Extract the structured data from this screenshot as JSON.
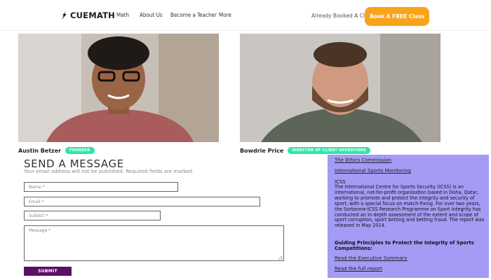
{
  "header": {
    "logo_text": "CUEMATH",
    "nav": [
      "Math",
      "About Us",
      "Become a Teacher",
      "More"
    ],
    "already_booked": "Already Booked A Class?",
    "cta_label": "Book A FREE Class"
  },
  "people": [
    {
      "name": "Austin Betzer",
      "role": "FOUNDER"
    },
    {
      "name": "Bowdrie Price",
      "role": "DIRECTOR OF CLIENT OPERATIONS"
    }
  ],
  "form": {
    "title": "SEND A MESSAGE",
    "note": "Your email address will not be published. Required fields are marked.",
    "name_placeholder": "Name *",
    "email_placeholder": "Email *",
    "subject_placeholder": "Subject *",
    "message_placeholder": "Message *",
    "submit_label": "SUBMIT"
  },
  "panel": {
    "link_ethics": "The Ethics Commission",
    "link_monitoring": "International Sports Monitoring",
    "icss_heading": "ICSS",
    "icss_body": "The International Centre for Sports Security (ICSS) is an international, not-for-profit organisation based in Doha, Qatar, working to promote and protect the integrity and security of sport, with a special focus on match-fixing. For over two years, the Sorbonne-ICSS Research Programme on Sport Integrity has conducted an in-depth assessment of the extent and scope of sport corruption, sport betting and betting fraud. The report was released in May 2014.",
    "guiding": "Guiding Principles to Protect the Integrity of Sports Competitions:",
    "link_exec": "Read the Executive Summary",
    "link_full": "Read the full report"
  },
  "colors": {
    "cta": "#f9a31b",
    "badge": "#2ee6a8",
    "submit": "#5b0f66",
    "panel": "#a49bf5"
  }
}
